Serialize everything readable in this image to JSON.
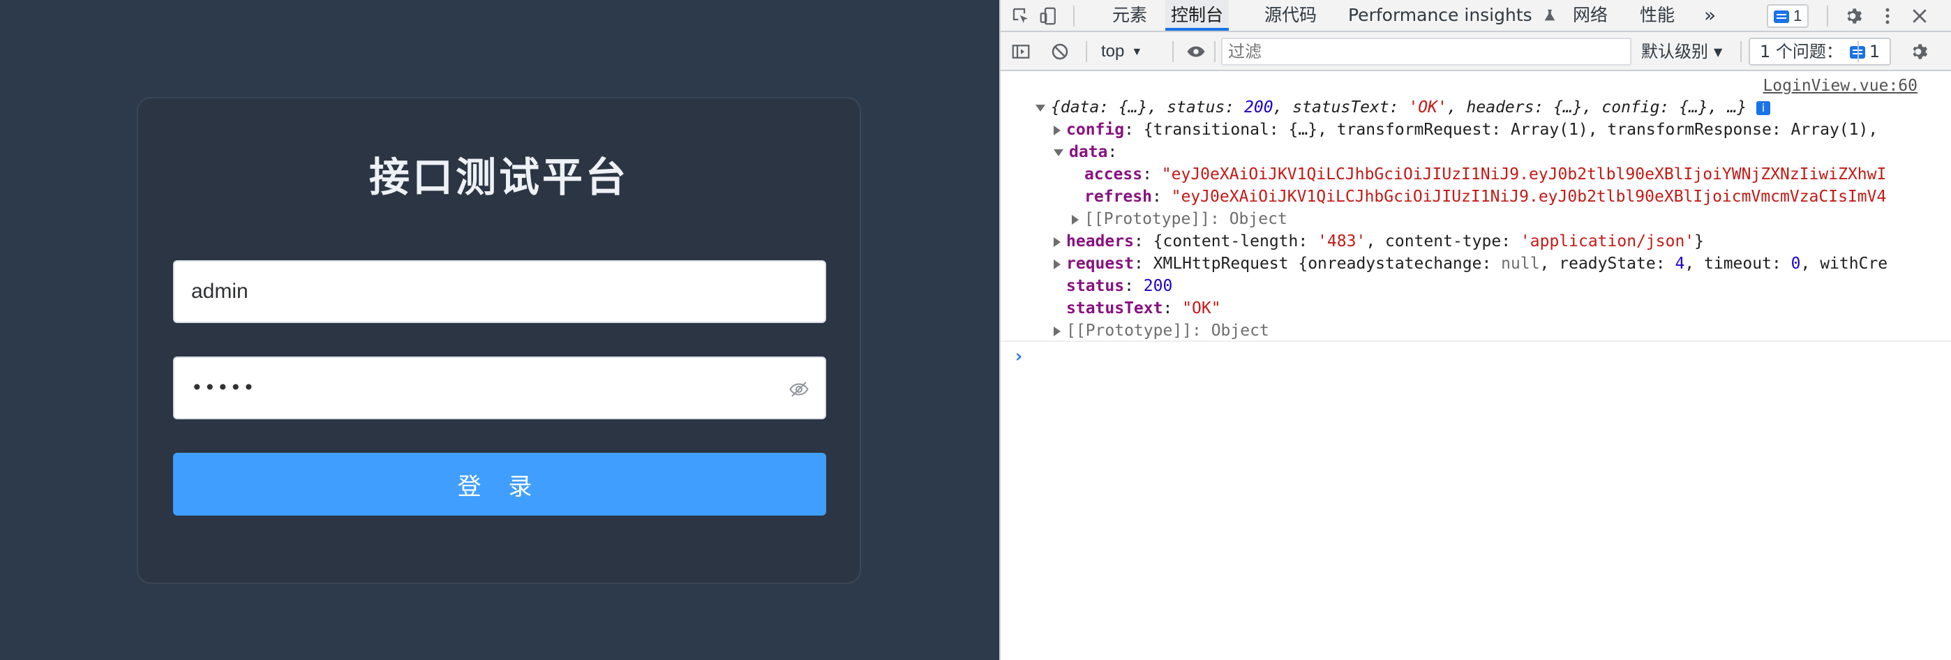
{
  "login": {
    "title": "接口测试平台",
    "username_value": "admin",
    "password_mask": "•••••",
    "submit_label": "登 录"
  },
  "devtools": {
    "tabs": [
      "元素",
      "控制台",
      "源代码",
      "Performance insights",
      "网络",
      "性能"
    ],
    "active_tab": "控制台",
    "more_tabs": "»",
    "message_count": "1",
    "context": "top",
    "filter_placeholder": "过滤",
    "log_level": "默认级别",
    "issues_label": "1 个问题：",
    "issues_count": "1"
  },
  "console": {
    "source": "LoginView.vue:60",
    "summary": {
      "open": "{",
      "data_key": "data",
      "data_val": "{…}",
      "status_key": "status",
      "status_val": "200",
      "statusText_key": "statusText",
      "statusText_val": "'OK'",
      "headers_key": "headers",
      "headers_val": "{…}",
      "config_key": "config",
      "config_val": "{…}",
      "tail": "…}"
    },
    "config": {
      "key": "config",
      "val": "{transitional: {…}, transformRequest: Array(1), transformResponse: Array(1),"
    },
    "data_key": "data",
    "access": {
      "key": "access",
      "val": "\"eyJ0eXAiOiJKV1QiLCJhbGciOiJIUzI1NiJ9.eyJ0b2tlbl90eXBlIjoiYWNjZXNzIiwiZXhwI"
    },
    "refresh": {
      "key": "refresh",
      "val": "\"eyJ0eXAiOiJKV1QiLCJhbGciOiJIUzI1NiJ9.eyJ0b2tlbl90eXBlIjoicmVmcmVzaCIsImV4"
    },
    "proto_inner": "[[Prototype]]: Object",
    "headers": {
      "key": "headers",
      "open": "{",
      "cl_key": "content-length",
      "cl_val": "'483'",
      "ct_key": "content-type",
      "ct_val": "'application/json'",
      "close": "}"
    },
    "request": {
      "key": "request",
      "type": "XMLHttpRequest {",
      "orc_key": "onreadystatechange",
      "orc_val": "null",
      "rs_key": "readyState",
      "rs_val": "4",
      "to_key": "timeout",
      "to_val": "0",
      "tail": "withCre"
    },
    "status": {
      "key": "status",
      "val": "200"
    },
    "statusText": {
      "key": "statusText",
      "val": "\"OK\""
    },
    "proto_outer": "[[Prototype]]: Object",
    "prompt": "›"
  }
}
